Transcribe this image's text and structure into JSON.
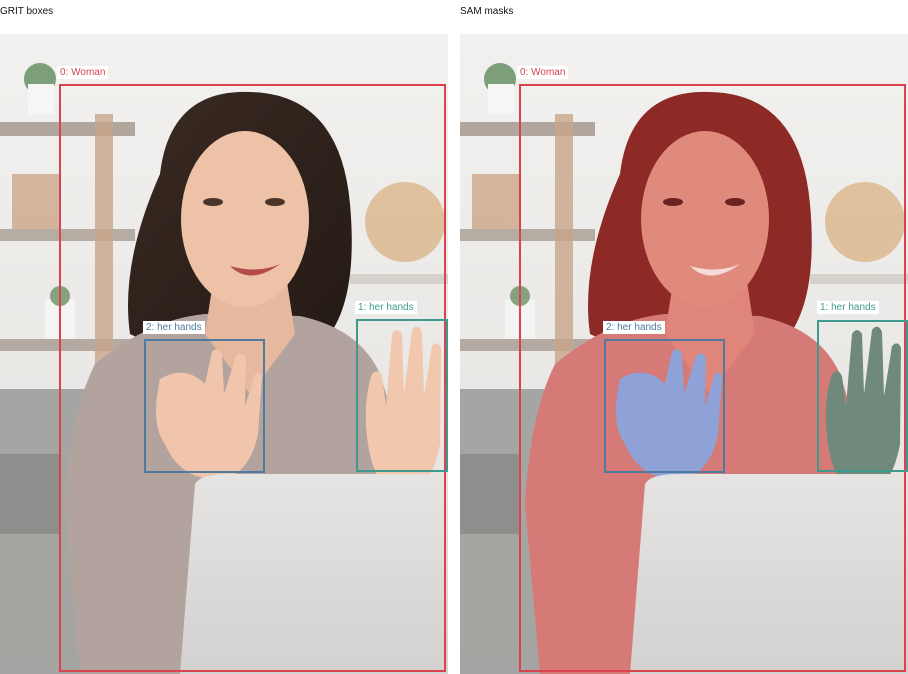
{
  "panels": [
    {
      "title": "GRIT boxes"
    },
    {
      "title": "SAM masks"
    }
  ],
  "detections": [
    {
      "label": "0: Woman",
      "color": "#d9434e"
    },
    {
      "label": "1: her hands",
      "color": "#3f9a8e"
    },
    {
      "label": "2: her hands",
      "color": "#4d7a9e"
    }
  ],
  "mask_colors": {
    "woman": "#d23a3a",
    "hands_right": "#5f8a7a",
    "hands_left": "#8ea2d8"
  }
}
